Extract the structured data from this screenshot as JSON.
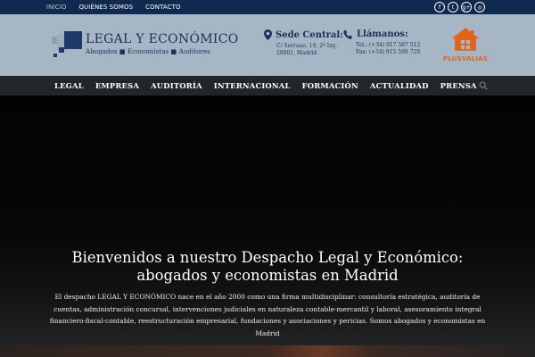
{
  "topnav": {
    "items": [
      "INICIO",
      "QUIÉNES SOMOS",
      "CONTACTO"
    ],
    "active": "INICIO"
  },
  "social": {
    "icons": [
      "facebook-icon",
      "twitter-icon",
      "google-plus-icon",
      "instagram-icon"
    ],
    "glyphs": [
      "f",
      "t",
      "g+",
      "◎"
    ]
  },
  "logo": {
    "name": "LEGAL Y ECONÓMICO",
    "tagline": "Abogados ■ Economistas ■ Auditores"
  },
  "sede": {
    "title": "Sede Central:",
    "address": "C/ Serrano, 19, 2º Izq.",
    "city": "28001, Madrid"
  },
  "llamanos": {
    "title": "Llámanos:",
    "tel": "Tel.: (+34) 917 587 512",
    "fax": "Fax: (+34) 915 599 729"
  },
  "plusvalias": {
    "label": "PLUSVALIAS"
  },
  "mainnav": {
    "items": [
      "LEGAL",
      "EMPRESA",
      "AUDITORÍA",
      "INTERNACIONAL",
      "FORMACIÓN",
      "ACTUALIDAD",
      "PRENSA"
    ]
  },
  "hero": {
    "title": "Bienvenidos a nuestro Despacho Legal y Económico: abogados y economistas en Madrid",
    "text": "El despacho LEGAL Y ECONÓMICO nace en el año 2000 como una firma multidisciplinar: consultoría estratégica, auditoría de cuentas, administración concursal, intervenciones judiciales en naturaleza contable-mercantil y laboral, asesoramiento integral financiero-fiscal-contable, reestructuración empresarial, fundaciones y asociaciones y pericias. Somos abogados y economistas en Madrid"
  },
  "colors": {
    "topbar": "#0f2a4e",
    "header": "#a7b6c5",
    "brand": "#1c2f55",
    "nav": "#222628",
    "accent": "#e2621a"
  }
}
